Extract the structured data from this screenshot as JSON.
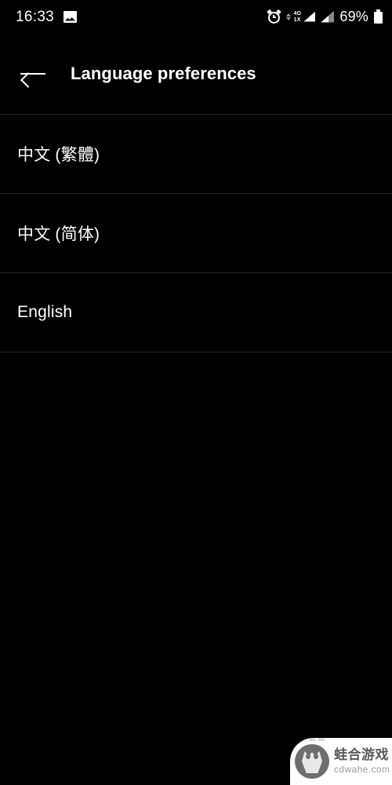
{
  "statusbar": {
    "time": "16:33",
    "photo_icon": "photo-icon",
    "alarm_icon": "alarm-clock-icon",
    "network_label_primary": "4G",
    "network_label_secondary": "1X",
    "signal_icon_1": "signal-bars-icon",
    "signal_icon_2": "signal-bars-icon",
    "battery_percent": "69%",
    "battery_icon": "battery-icon"
  },
  "appbar": {
    "back_icon": "arrow-left-icon",
    "title": "Language preferences"
  },
  "list": {
    "items": [
      {
        "label": "中文 (繁體)"
      },
      {
        "label": "中文 (简体)"
      },
      {
        "label": "English"
      }
    ]
  },
  "watermark": {
    "brand_cn": "蛙合游戏",
    "brand_url": "cdwahe.com",
    "logo_icon": "frog-logo-icon"
  },
  "colors": {
    "background": "#000000",
    "text_primary": "#ffffff",
    "divider": "#232323",
    "watermark_bg": "#ffffff"
  }
}
